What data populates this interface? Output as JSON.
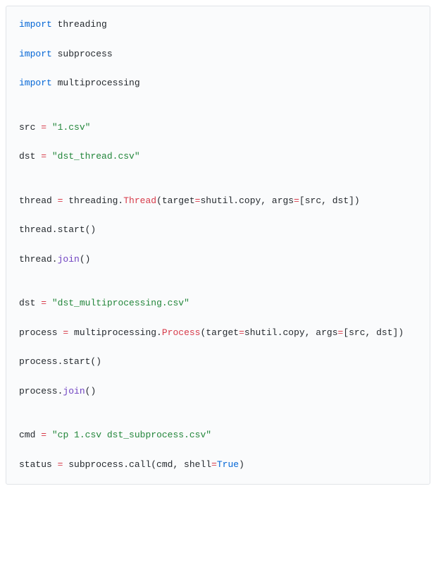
{
  "code": {
    "l01_import": "import",
    "l01_mod": " threading",
    "l03_import": "import",
    "l03_mod": " subprocess",
    "l05_import": "import",
    "l05_mod": " multiprocessing",
    "l08_a": "src ",
    "l08_op": "=",
    "l08_b": " ",
    "l08_str": "\"1.csv\"",
    "l10_a": "dst ",
    "l10_op": "=",
    "l10_b": " ",
    "l10_str": "\"dst_thread.csv\"",
    "l13_a": "thread ",
    "l13_op": "=",
    "l13_b": " threading.",
    "l13_cls": "Thread",
    "l13_c": "(target",
    "l13_op2": "=",
    "l13_d": "shutil.copy, args",
    "l13_op3": "=",
    "l13_e": "[src, dst])",
    "l15_a": "thread.start()",
    "l17_a": "thread.",
    "l17_m": "join",
    "l17_b": "()",
    "l20_a": "dst ",
    "l20_op": "=",
    "l20_b": " ",
    "l20_str": "\"dst_multiprocessing.csv\"",
    "l22_a": "process ",
    "l22_op": "=",
    "l22_b": " multiprocessing.",
    "l22_cls": "Process",
    "l22_c": "(target",
    "l22_op2": "=",
    "l22_d": "shutil.copy, args",
    "l22_op3": "=",
    "l22_e": "[src, dst])",
    "l24_a": "process.start()",
    "l26_a": "process.",
    "l26_m": "join",
    "l26_b": "()",
    "l29_a": "cmd ",
    "l29_op": "=",
    "l29_b": " ",
    "l29_str": "\"cp 1.csv dst_subprocess.csv\"",
    "l31_a": "status ",
    "l31_op": "=",
    "l31_b": " subprocess.call(cmd, shell",
    "l31_op2": "=",
    "l31_bool": "True",
    "l31_c": ")"
  }
}
